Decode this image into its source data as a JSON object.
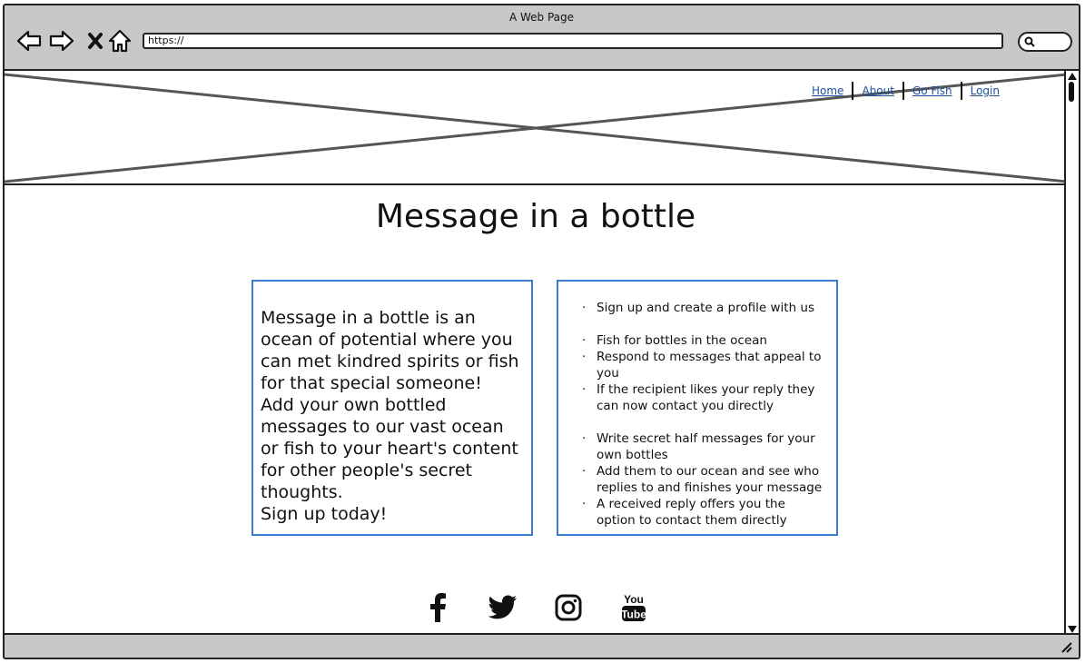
{
  "window": {
    "title": "A Web Page"
  },
  "browser": {
    "url": "https://"
  },
  "nav": {
    "items": [
      {
        "label": "Home"
      },
      {
        "label": "About"
      },
      {
        "label": "Go Fish"
      },
      {
        "label": "Login"
      }
    ]
  },
  "main": {
    "title": "Message in a bottle",
    "intro": {
      "paragraphs": [
        "Message in a bottle is an ocean of potential where you can met kindred spirits or fish for that special someone!",
        "Add your own bottled messages to our vast ocean or fish to your heart's content for other people's secret thoughts.",
        "Sign up today!"
      ]
    },
    "features": [
      "Sign up and create a profile with us",
      "Fish for bottles in the ocean",
      "Respond to messages that appeal to you",
      "If the recipient likes your reply they can now contact you directly",
      "Write secret half messages for your own bottles",
      "Add them to our ocean and see who replies to and finishes your message",
      "A received reply offers you the option to contact them directly"
    ]
  },
  "social": {
    "icons": [
      "facebook-icon",
      "twitter-icon",
      "instagram-icon",
      "youtube-icon"
    ],
    "youtube_text_top": "You",
    "youtube_text_bottom": "Tube"
  },
  "colors": {
    "box_border": "#3a7bd5",
    "link": "#1a4f9c",
    "chrome": "#c8c8c8"
  }
}
